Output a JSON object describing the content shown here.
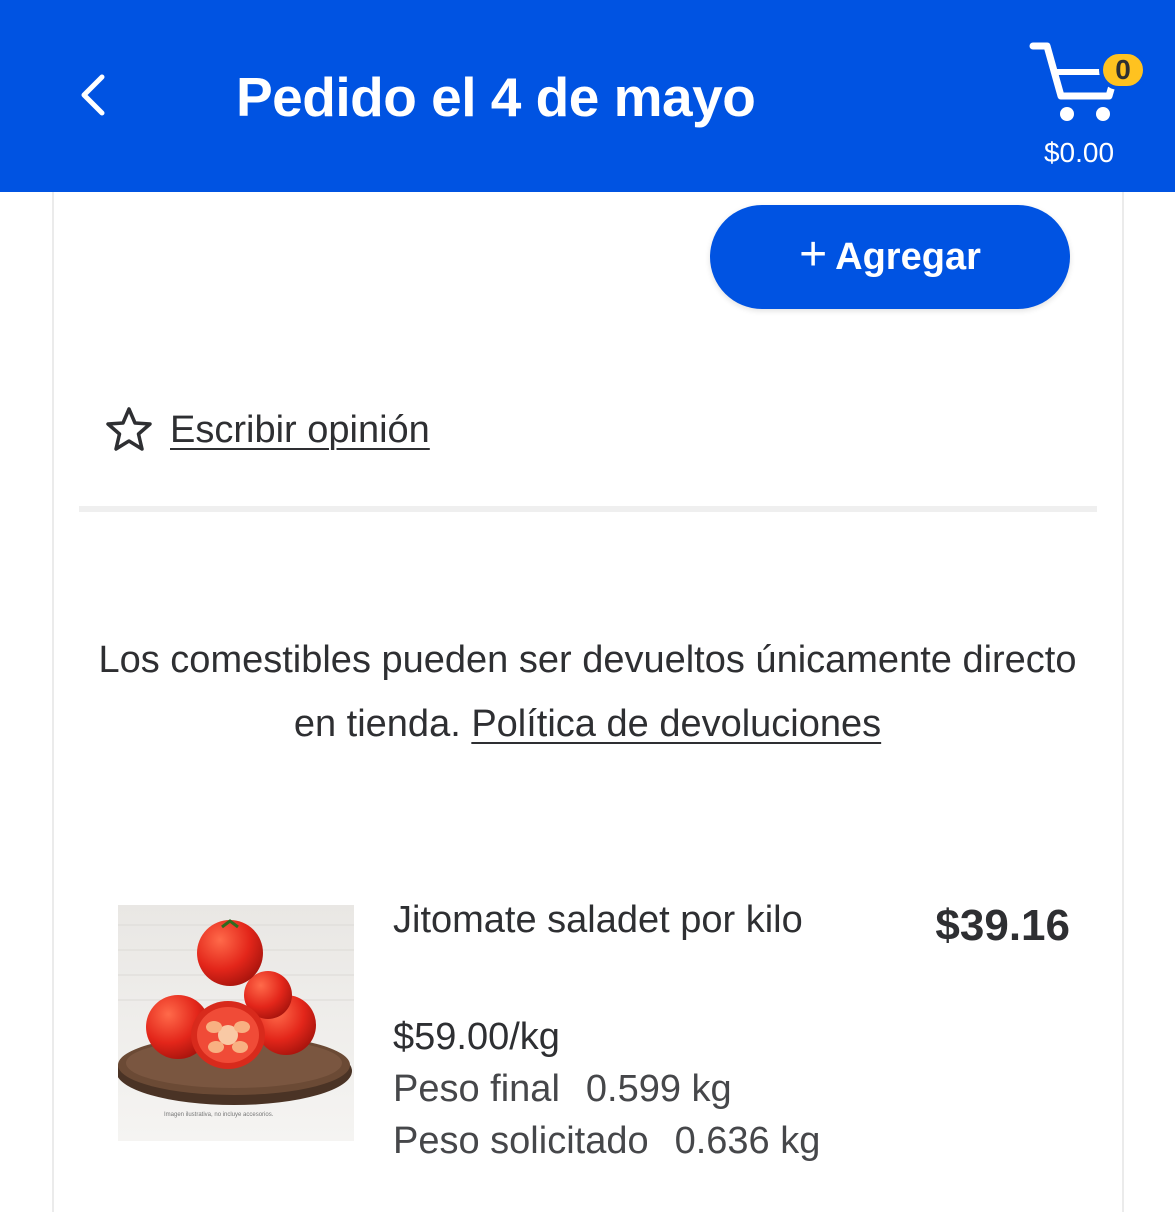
{
  "header": {
    "title": "Pedido el 4 de mayo",
    "back_icon": "chevron-left-icon",
    "cart": {
      "icon": "shopping-cart-icon",
      "count": "0",
      "total": "$0.00"
    }
  },
  "actions": {
    "add_label": "Agregar",
    "add_icon": "plus-icon"
  },
  "review": {
    "icon": "star-outline-icon",
    "label": "Escribir opinión"
  },
  "returns": {
    "text": "Los comestibles pueden ser devueltos únicamente directo en tienda.",
    "link": "Política de devoluciones"
  },
  "product": {
    "name": "Jitomate saladet por kilo",
    "price": "$39.16",
    "unit_price": "$59.00/kg",
    "final_weight_label": "Peso final",
    "final_weight": "0.599 kg",
    "requested_weight_label": "Peso solicitado",
    "requested_weight": "0.636 kg",
    "image_caption": "Imagen ilustrativa, no incluye accesorios."
  },
  "colors": {
    "brand_blue": "#0053e2",
    "badge_yellow": "#ffc220",
    "text": "#2e2f32"
  }
}
